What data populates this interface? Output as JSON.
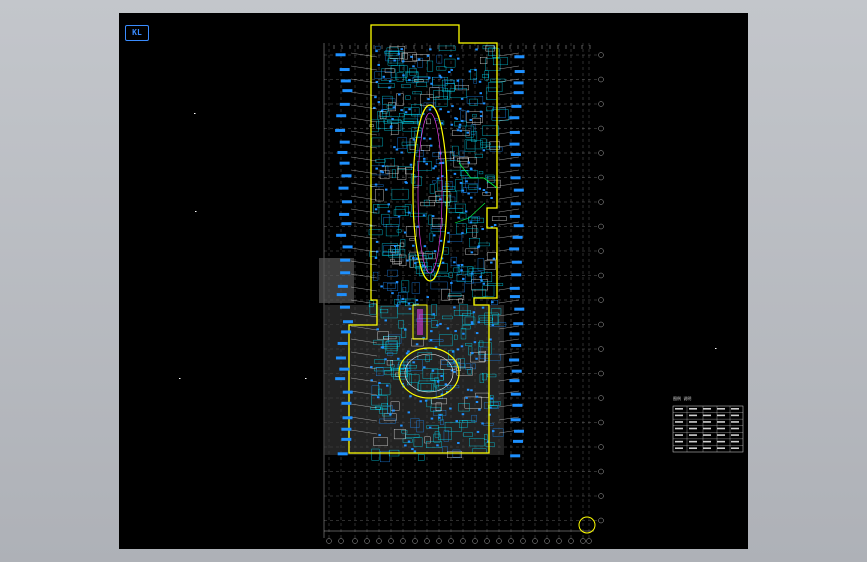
{
  "app": {
    "window_state": "cad-model-view"
  },
  "sheet": {
    "logo_text": "KL",
    "background_color": "#000000",
    "viewport_color": "#b9bcc2"
  },
  "colors": {
    "wall_outline": "#ffff00",
    "pipe_blue": "#1e90ff",
    "cyan_lines": "#00e5ff",
    "white_text": "#ffffff",
    "grid_line": "#9a9a9a",
    "magenta": "#ff40ff",
    "green": "#00ff40",
    "grey_fill": "#8a8a8a"
  },
  "legend": {
    "title": "图例  说明",
    "rows": 6
  },
  "icons": {
    "north_marker": "circle-marker-icon"
  }
}
